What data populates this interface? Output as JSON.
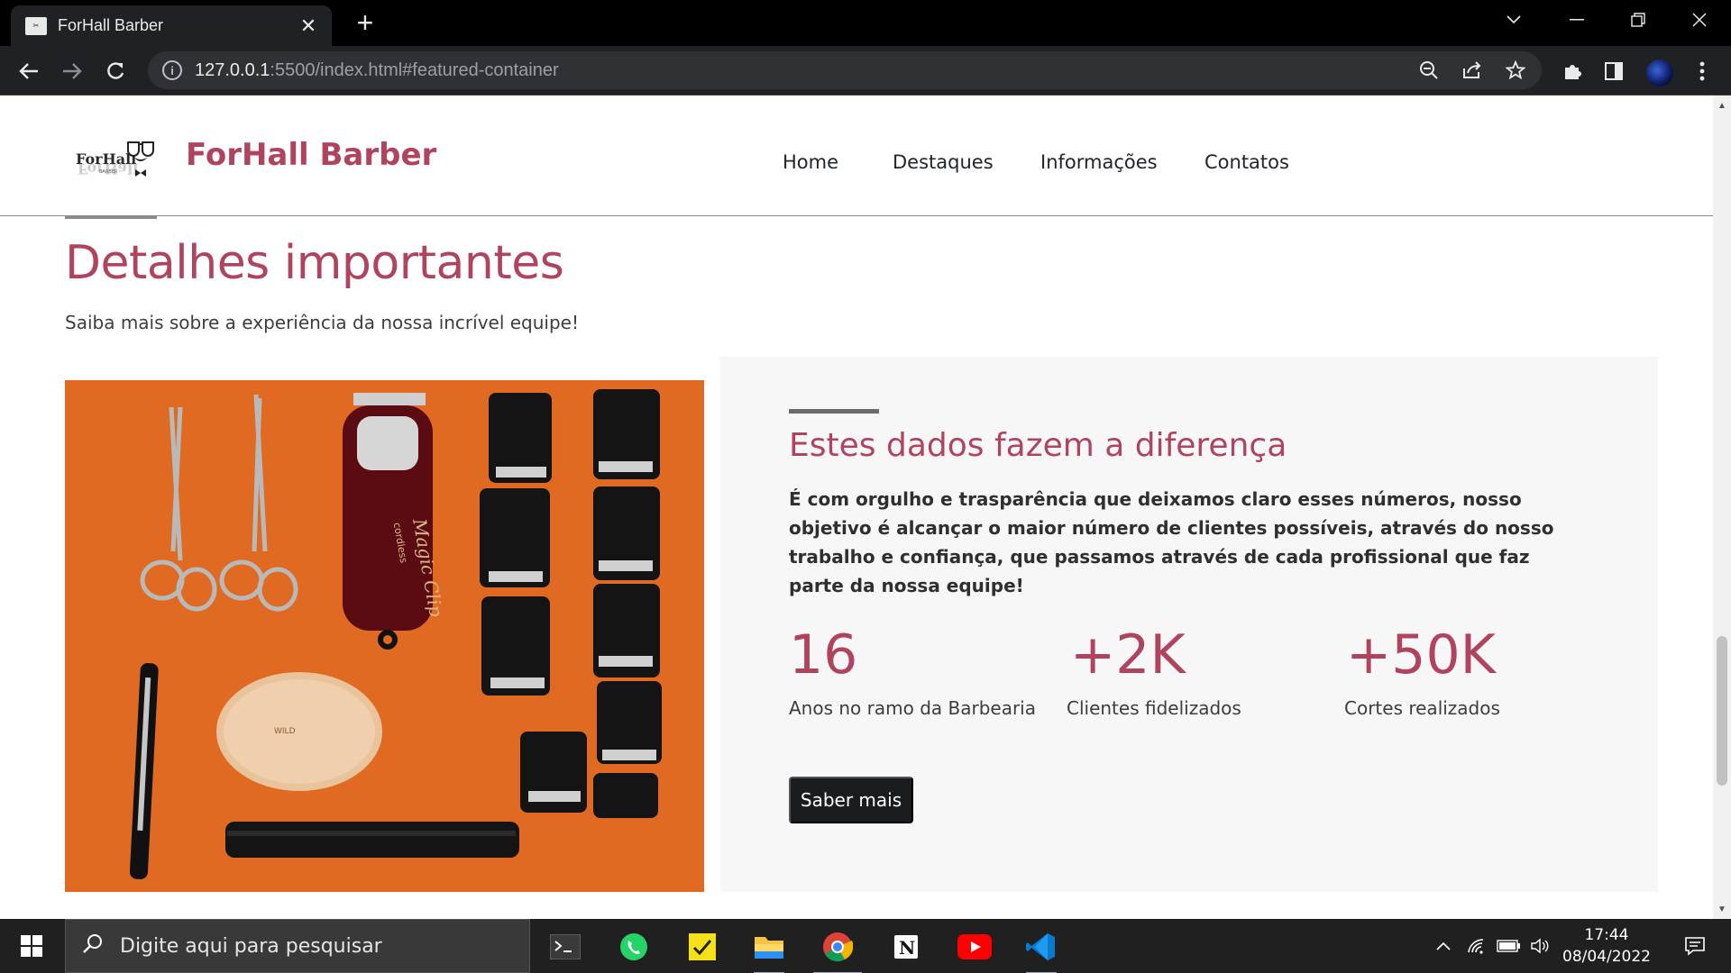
{
  "browser": {
    "tab_title": "ForHall Barber",
    "url_host": "127.0.0.1",
    "url_rest": ":5500/index.html#featured-container",
    "new_tab": "+",
    "tab_close": "✕"
  },
  "navbar": {
    "brand": "ForHall Barber",
    "logo_text": "ForHall",
    "logo_subtext": "BARBER",
    "links": [
      "Home",
      "Destaques",
      "Informações",
      "Contatos"
    ]
  },
  "section": {
    "title": "Detalhes importantes",
    "subtitle": "Saiba mais sobre a experiência da nossa incrível equipe!"
  },
  "panel": {
    "heading": "Estes dados fazem a diferença",
    "lead": "É com orgulho e trasparência que deixamos claro esses números, nosso objetivo é alcançar o maior número de clientes possíveis, através do nosso trabalho e confiança, que passamos através de cada profissional que faz parte da nossa equipe!",
    "stats": [
      {
        "value": "16",
        "label": "Anos no ramo da Barbearia"
      },
      {
        "value": "+2K",
        "label": "Clientes fidelizados"
      },
      {
        "value": "+50K",
        "label": "Cortes realizados"
      }
    ],
    "cta": "Saber mais"
  },
  "photo": {
    "clipper_text": "Magic Clip",
    "clipper_sub": "cordless",
    "icon": "barber-tools-photo"
  },
  "taskbar": {
    "search_placeholder": "Digite aqui para pesquisar",
    "time": "17:44",
    "date": "08/04/2022",
    "apps": [
      "terminal-icon",
      "whatsapp-icon",
      "sticky-notes-icon",
      "file-explorer-icon",
      "chrome-icon",
      "notion-icon",
      "youtube-icon",
      "vscode-icon"
    ]
  },
  "colors": {
    "accent": "#b0445f",
    "photo_bg": "#e06a22",
    "panel_bg": "#f7f7f8",
    "button_bg": "#1a1d20"
  }
}
